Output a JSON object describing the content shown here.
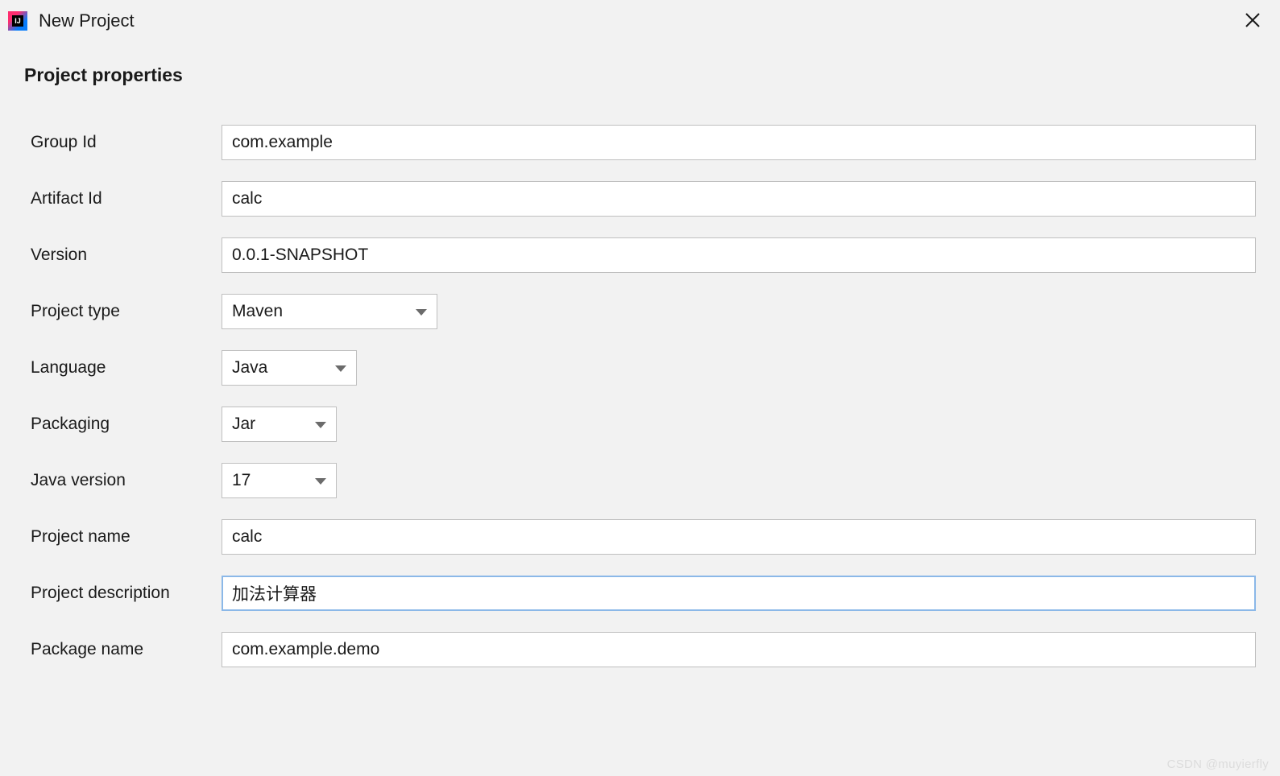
{
  "window": {
    "title": "New Project"
  },
  "section": {
    "title": "Project properties"
  },
  "form": {
    "group_id": {
      "label": "Group Id",
      "value": "com.example"
    },
    "artifact_id": {
      "label": "Artifact Id",
      "value": "calc"
    },
    "version": {
      "label": "Version",
      "value": "0.0.1-SNAPSHOT"
    },
    "project_type": {
      "label": "Project type",
      "value": "Maven"
    },
    "language": {
      "label": "Language",
      "value": "Java"
    },
    "packaging": {
      "label": "Packaging",
      "value": "Jar"
    },
    "java_version": {
      "label": "Java version",
      "value": "17"
    },
    "project_name": {
      "label": "Project name",
      "value": "calc"
    },
    "project_description": {
      "label": "Project description",
      "value": "加法计算器"
    },
    "package_name": {
      "label": "Package name",
      "value": "com.example.demo"
    }
  },
  "watermark": "CSDN @muyierfly"
}
